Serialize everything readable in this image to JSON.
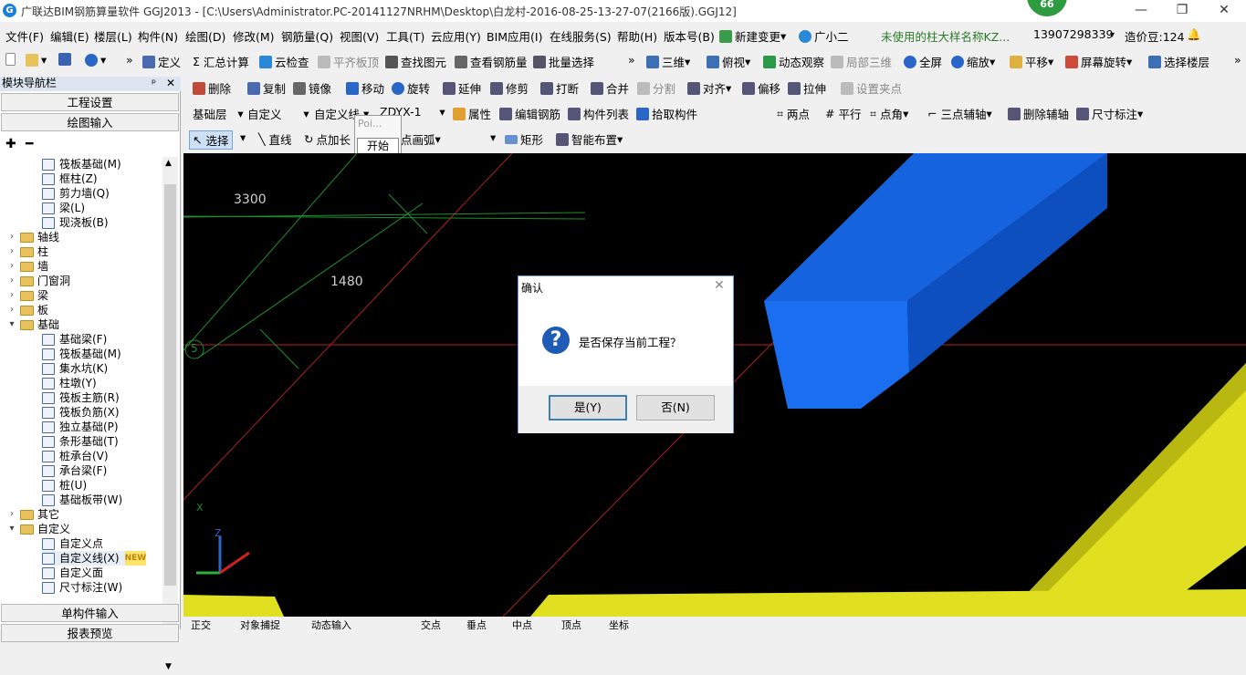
{
  "title": {
    "text": "广联达BIM钢筋算量软件 GGJ2013 - [C:\\Users\\Administrator.PC-20141127NRHM\\Desktop\\白龙村-2016-08-25-13-27-07(2166版).GGJ12]",
    "badge": "66",
    "min": "—",
    "restore": "❐",
    "close": "✕"
  },
  "menubar": {
    "items": [
      "文件(F)",
      "编辑(E)",
      "楼层(L)",
      "构件(N)",
      "绘图(D)",
      "修改(M)",
      "钢筋量(Q)",
      "视图(V)",
      "工具(T)",
      "云应用(Y)",
      "BIM应用(I)",
      "在线服务(S)",
      "帮助(H)",
      "版本号(B)",
      "新建变更",
      "广小二"
    ],
    "notice": "未使用的柱大样名称KZ...",
    "phone": "13907298339",
    "cost": "造价豆:124"
  },
  "toolbar1": {
    "items": [
      "定义",
      "汇总计算",
      "云检查",
      "平齐板顶",
      "查找图元",
      "查看钢筋量",
      "批量选择",
      "三维",
      "俯视",
      "动态观察",
      "局部三维",
      "全屏",
      "缩放",
      "平移",
      "屏幕旋转",
      "选择楼层"
    ]
  },
  "toolbar2": {
    "items": [
      "删除",
      "复制",
      "镜像",
      "移动",
      "旋转",
      "延伸",
      "修剪",
      "打断",
      "合并",
      "分割",
      "对齐",
      "偏移",
      "拉伸",
      "设置夹点"
    ]
  },
  "toolbar3": {
    "layer": "基础层",
    "type": "自定义",
    "subtype": "自定义线",
    "name": "ZDYX-1",
    "items": [
      "属性",
      "编辑钢筋",
      "构件列表",
      "拾取构件",
      "两点",
      "平行",
      "点角",
      "三点辅轴",
      "删除辅轴",
      "尺寸标注"
    ]
  },
  "toolbar4": {
    "items": [
      "选择",
      "直线",
      "点加长",
      "点画弧",
      "矩形",
      "智能布置"
    ]
  },
  "popup": {
    "top": "Poi...",
    "start": "开始"
  },
  "nav": {
    "header": "模块导航栏",
    "pin": "ᵖ",
    "close": "✕",
    "btn_project": "工程设置",
    "btn_draw": "绘图输入",
    "btn_single": "单构件输入",
    "btn_report": "报表预览"
  },
  "tree": [
    {
      "t": "筏板基础(M)",
      "lvl": 2
    },
    {
      "t": "框柱(Z)",
      "lvl": 2
    },
    {
      "t": "剪力墙(Q)",
      "lvl": 2
    },
    {
      "t": "梁(L)",
      "lvl": 2
    },
    {
      "t": "现浇板(B)",
      "lvl": 2
    },
    {
      "t": "轴线",
      "lvl": 1
    },
    {
      "t": "柱",
      "lvl": 1
    },
    {
      "t": "墙",
      "lvl": 1
    },
    {
      "t": "门窗洞",
      "lvl": 1
    },
    {
      "t": "梁",
      "lvl": 1
    },
    {
      "t": "板",
      "lvl": 1
    },
    {
      "t": "基础",
      "lvl": 1,
      "open": true
    },
    {
      "t": "基础梁(F)",
      "lvl": 2
    },
    {
      "t": "筏板基础(M)",
      "lvl": 2
    },
    {
      "t": "集水坑(K)",
      "lvl": 2
    },
    {
      "t": "柱墩(Y)",
      "lvl": 2
    },
    {
      "t": "筏板主筋(R)",
      "lvl": 2
    },
    {
      "t": "筏板负筋(X)",
      "lvl": 2
    },
    {
      "t": "独立基础(P)",
      "lvl": 2
    },
    {
      "t": "条形基础(T)",
      "lvl": 2
    },
    {
      "t": "桩承台(V)",
      "lvl": 2
    },
    {
      "t": "承台梁(F)",
      "lvl": 2
    },
    {
      "t": "桩(U)",
      "lvl": 2
    },
    {
      "t": "基础板带(W)",
      "lvl": 2
    },
    {
      "t": "其它",
      "lvl": 1
    },
    {
      "t": "自定义",
      "lvl": 1,
      "open": true
    },
    {
      "t": "自定义点",
      "lvl": 2
    },
    {
      "t": "自定义线(X)",
      "lvl": 2,
      "tag": "NEW"
    },
    {
      "t": "自定义面",
      "lvl": 2
    },
    {
      "t": "尺寸标注(W)",
      "lvl": 2
    }
  ],
  "canvas": {
    "dim1": "3300",
    "dim2": "1480",
    "axis": "5",
    "axis_z": "Z"
  },
  "dialog": {
    "title": "确认",
    "message": "是否保存当前工程？",
    "yes": "是(Y)",
    "no": "否(N)"
  },
  "statusbar": {
    "items": [
      "正交",
      "对象捕捉",
      "动态输入",
      "交点",
      "垂点",
      "中点",
      "顶点",
      "坐标"
    ]
  }
}
